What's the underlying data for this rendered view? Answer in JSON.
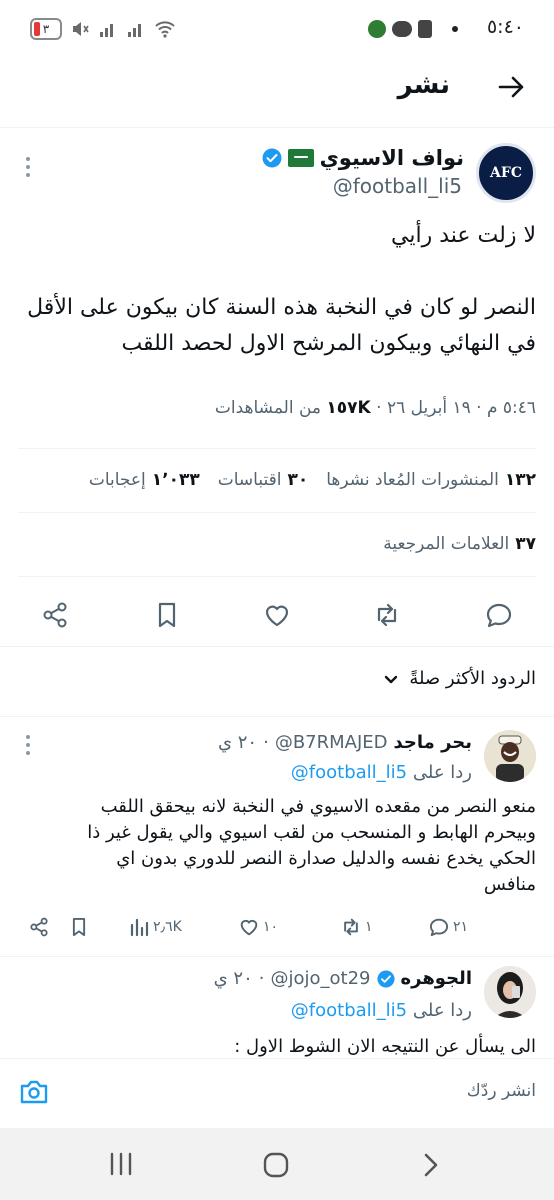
{
  "status_bar": {
    "time": "٥:٤٠",
    "battery_level": "٣"
  },
  "header": {
    "title": "نشر"
  },
  "tweet": {
    "author_name": "نواف الاسيوي",
    "author_handle": "@football_li5",
    "avatar_text": "AFC",
    "line1": "لا زلت عند رأيي",
    "line2": "النصر لو كان في النخبة هذه السنة كان بيكون على الأقل",
    "line3": "في النهائي وبيكون المرشح الاول لحصد اللقب",
    "meta_time": "٥:٤٦ م · ١٩ أبريل ٢٦ ·",
    "views_count": "١٥٧K",
    "views_label": "من المشاهدات",
    "reposts_count": "١٣٢",
    "reposts_label": "المنشورات المُعاد نشرها",
    "quotes_count": "٣٠",
    "quotes_label": "اقتباسات",
    "likes_count": "١٬٠٣٣",
    "likes_label": "إعجابات",
    "bookmarks_count": "٣٧",
    "bookmarks_label": "العلامات المرجعية"
  },
  "replies_sort_label": "الردود الأكثر صلةً",
  "replies": [
    {
      "name": "بحر ماجد",
      "handle": "@B7RMAJED",
      "time": "٢٠ ي",
      "reply_to_prefix": "ردا على",
      "reply_to_handle": "@football_li5",
      "text": "منعو النصر من مقعده الاسيوي في النخبة لانه بيحقق اللقب وبيحرم الهابط و المنسحب من لقب اسيوي والي يقول غير ذا الحكي يخدع نفسه والدليل صدارة النصر للدوري بدون اي منافس",
      "replies_count": "٢١",
      "reposts_count": "١",
      "likes_count": "١٠",
      "views_count": "٢٫٦K"
    },
    {
      "name": "الجوهره",
      "handle": "@jojo_ot29",
      "time": "٢٠ ي",
      "reply_to_prefix": "ردا على",
      "reply_to_handle": "@football_li5",
      "text": "الى يسأل عن النتيجه الان الشوط الاول :"
    }
  ],
  "compose": {
    "placeholder": "انشر ردّك"
  },
  "colors": {
    "accent": "#1d9bf0",
    "text": "#0f1419",
    "muted": "#536471",
    "divider": "#eff3f4"
  },
  "icons": [
    "back-arrow-icon",
    "more-vertical-icon",
    "verified-badge-icon",
    "reply-icon",
    "repost-icon",
    "like-icon",
    "bookmark-icon",
    "share-icon",
    "chevron-down-icon",
    "views-icon",
    "camera-icon"
  ]
}
